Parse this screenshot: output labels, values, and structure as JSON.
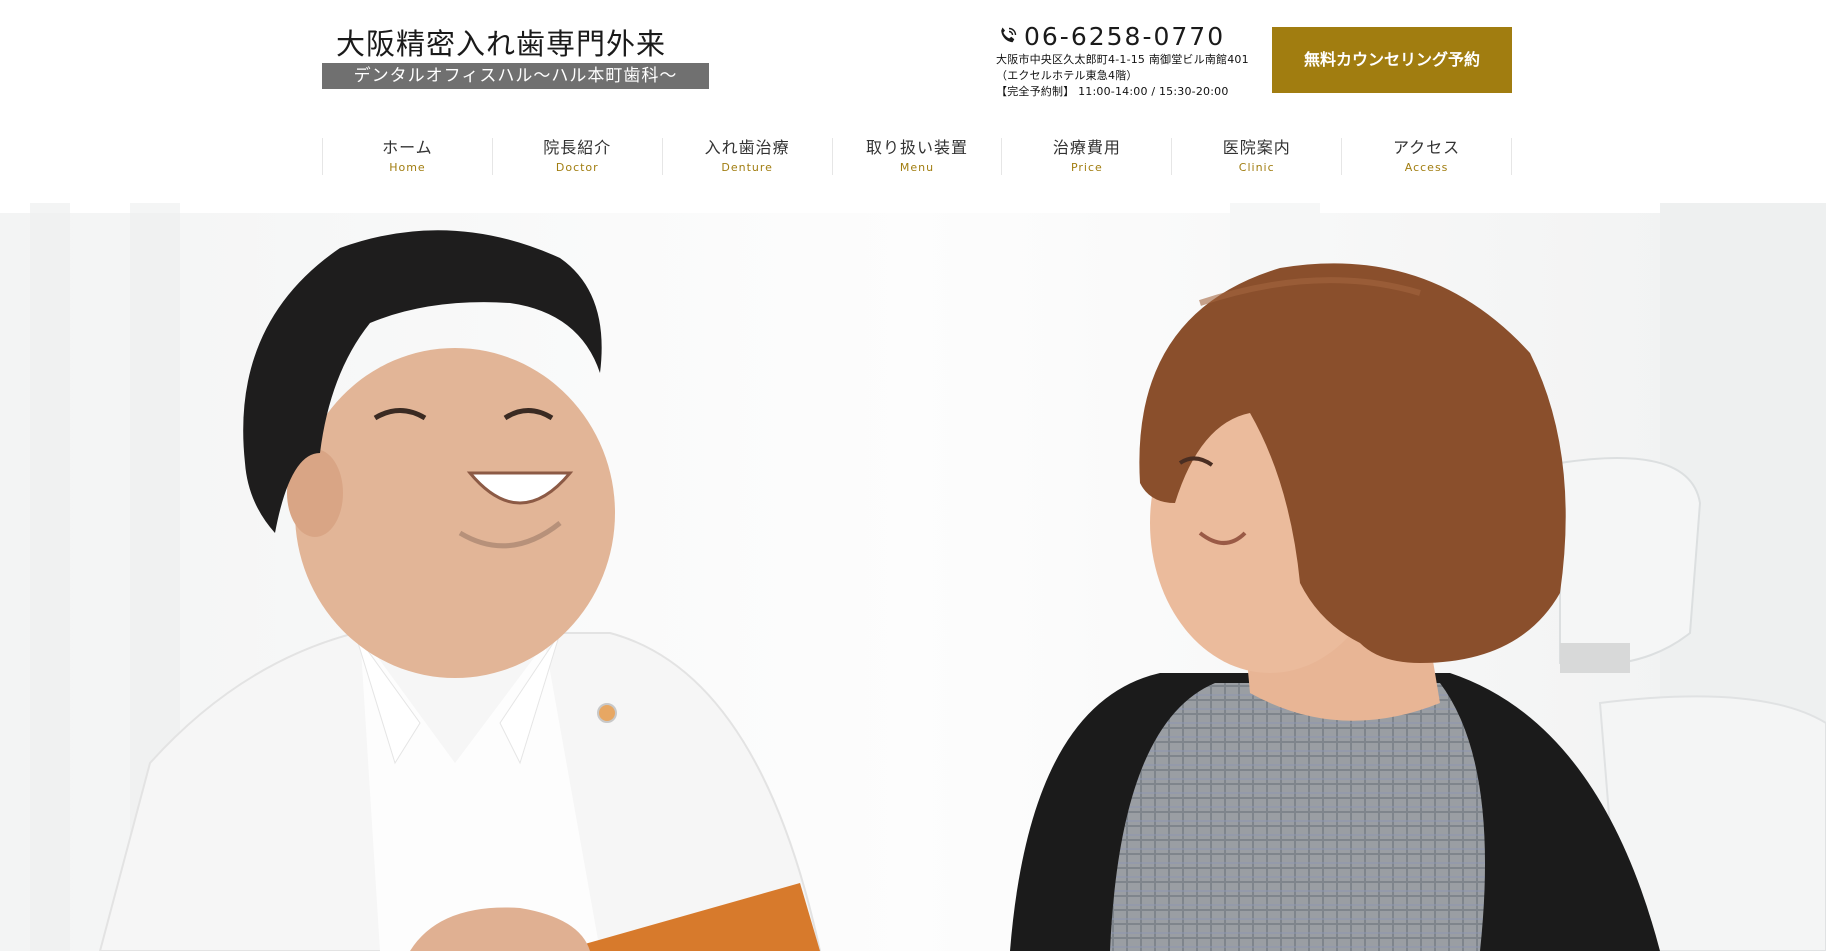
{
  "logo": {
    "title": "大阪精密入れ歯専門外来",
    "subtitle": "デンタルオフィスハル〜ハル本町歯科〜"
  },
  "contact": {
    "phone_icon": "phone-icon",
    "phone": "06-6258-0770",
    "address": "大阪市中央区久太郎町4-1-15 南御堂ビル南館401",
    "building": "（エクセルホテル東急4階）",
    "hours": "【完全予約制】 11:00-14:00 / 15:30-20:00"
  },
  "cta": {
    "label": "無料カウンセリング予約",
    "color": "#a17d10"
  },
  "nav": {
    "items": [
      {
        "jp": "ホーム",
        "en": "Home"
      },
      {
        "jp": "院長紹介",
        "en": "Doctor"
      },
      {
        "jp": "入れ歯治療",
        "en": "Denture"
      },
      {
        "jp": "取り扱い装置",
        "en": "Menu"
      },
      {
        "jp": "治療費用",
        "en": "Price"
      },
      {
        "jp": "医院案内",
        "en": "Clinic"
      },
      {
        "jp": "アクセス",
        "en": "Access"
      }
    ]
  },
  "hero": {
    "image": "dentist-and-patient-smiling-photo"
  }
}
